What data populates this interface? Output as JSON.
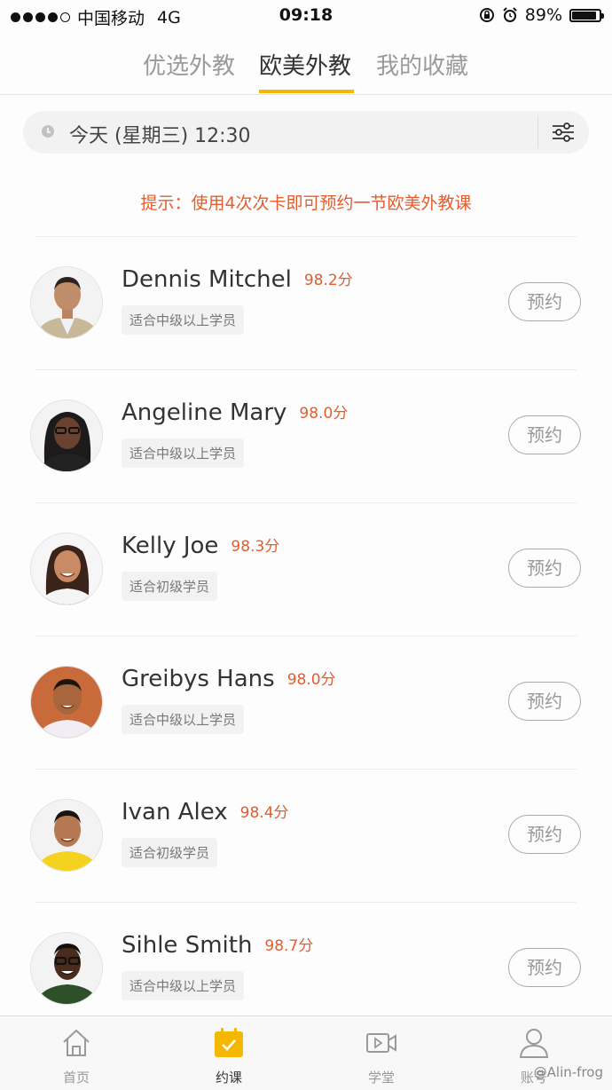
{
  "status_bar": {
    "carrier": "中国移动",
    "network": "4G",
    "time": "09:18",
    "battery_text": "89%",
    "battery_level": 0.89
  },
  "tabs": [
    {
      "label": "优选外教",
      "active": false
    },
    {
      "label": "欧美外教",
      "active": true
    },
    {
      "label": "我的收藏",
      "active": false
    }
  ],
  "time_filter": {
    "value": "今天 (星期三)  12:30"
  },
  "tip": "提示：使用4次次卡即可预约一节欧美外教课",
  "teachers": [
    {
      "name": "Dennis Mitchel",
      "score": "98.2分",
      "level": "适合中级以上学员",
      "button": "预约"
    },
    {
      "name": "Angeline Mary",
      "score": "98.0分",
      "level": "适合中级以上学员",
      "button": "预约"
    },
    {
      "name": "Kelly Joe",
      "score": "98.3分",
      "level": "适合初级学员",
      "button": "预约"
    },
    {
      "name": "Greibys Hans",
      "score": "98.0分",
      "level": "适合中级以上学员",
      "button": "预约"
    },
    {
      "name": "Ivan Alex",
      "score": "98.4分",
      "level": "适合初级学员",
      "button": "预约"
    },
    {
      "name": "Sihle Smith",
      "score": "98.7分",
      "level": "适合中级以上学员",
      "button": "预约"
    }
  ],
  "bottom_nav": [
    {
      "label": "首页",
      "icon": "home-icon"
    },
    {
      "label": "约课",
      "icon": "calendar-icon",
      "active": true
    },
    {
      "label": "学堂",
      "icon": "video-icon"
    },
    {
      "label": "账号",
      "icon": "user-icon"
    }
  ],
  "watermark": "@Alin-frog",
  "colors": {
    "accent": "#f5b800",
    "score": "#e65c2c",
    "tip": "#e65c2c"
  }
}
